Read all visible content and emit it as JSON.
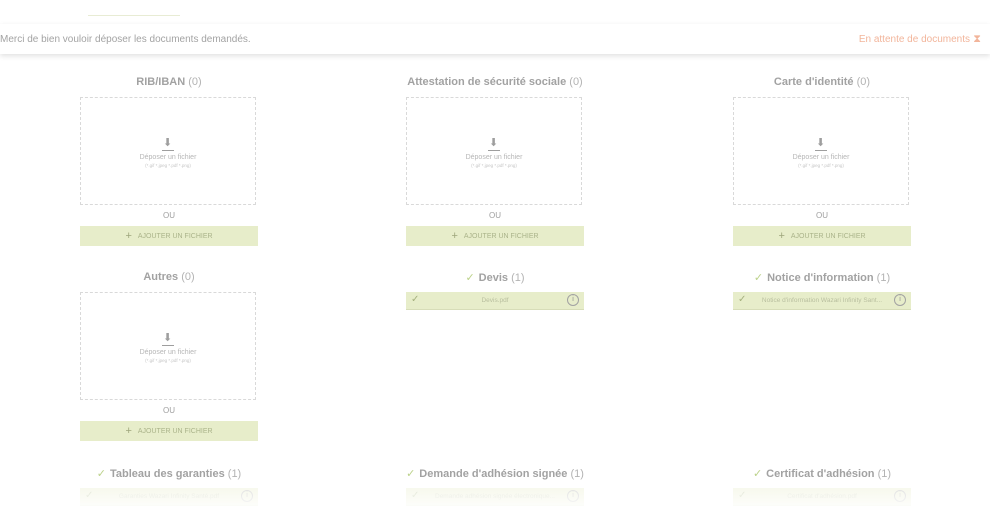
{
  "header": {
    "message": "Merci de bien vouloir déposer les documents demandés.",
    "status": "En attente de documents",
    "status_icon": "hourglass-icon"
  },
  "upload": {
    "drop_label": "Déposer un fichier",
    "drop_formats": "(*.gif *.jpeg *.pdf *.png)",
    "or_label": "OU",
    "add_button": "AJOUTER UN FICHIER"
  },
  "sections": [
    {
      "title": "RIB/IBAN",
      "count": "(0)"
    },
    {
      "title": "Attestation de sécurité sociale",
      "count": "(0)"
    },
    {
      "title": "Carte d'identité",
      "count": "(0)"
    },
    {
      "title": "Autres",
      "count": "(0)"
    },
    {
      "title": "Devis",
      "count": "(1)",
      "file": "Devis.pdf"
    },
    {
      "title": "Notice d'information",
      "count": "(1)",
      "file": "Notice d'information Wazari Infinity Sant..."
    },
    {
      "title": "Tableau des garanties",
      "count": "(1)",
      "file": "Garanties Wazari Infinity Santé.pdf"
    },
    {
      "title": "Demande d'adhésion signée",
      "count": "(1)",
      "file": "Demande adhésion signée électronique..."
    },
    {
      "title": "Certificat d'adhésion",
      "count": "(1)",
      "file": "Certificat d'adhésion.pdf"
    }
  ],
  "colors": {
    "accent": "#e7edca",
    "check": "#bcd28a",
    "status": "#f2b59b"
  }
}
